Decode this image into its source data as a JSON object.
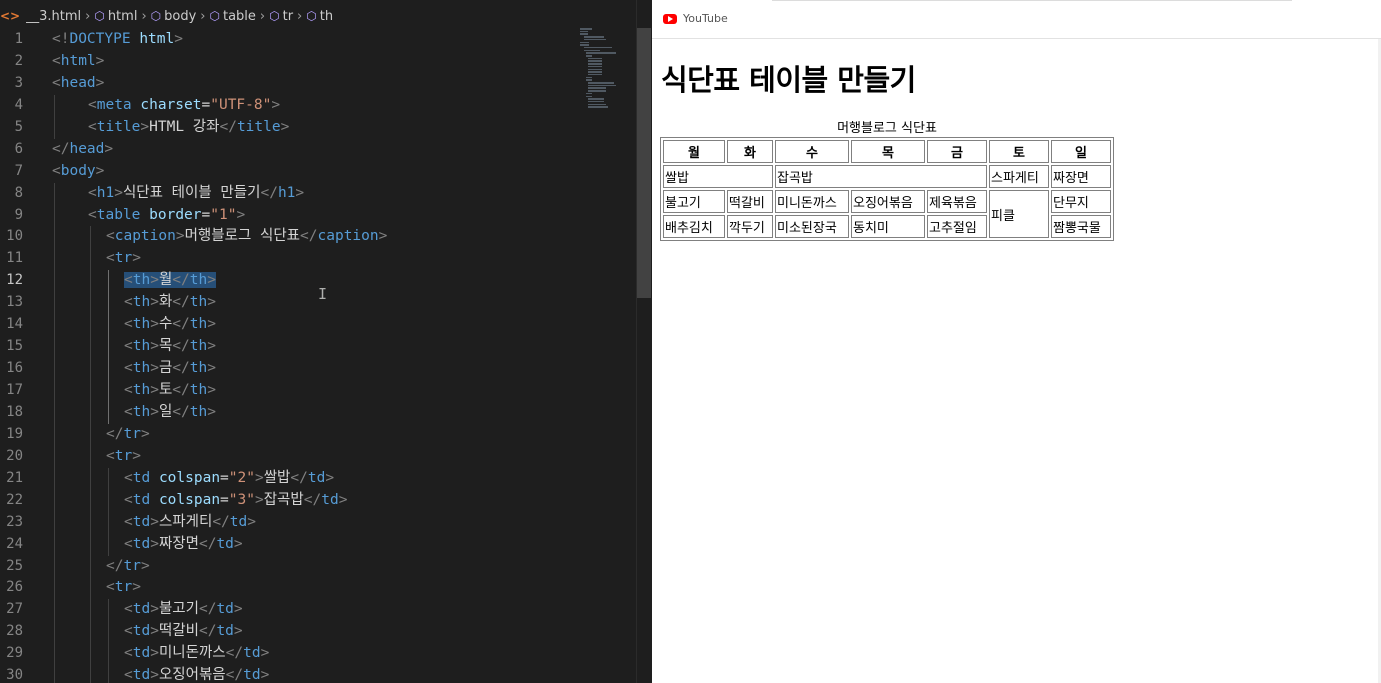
{
  "breadcrumb": {
    "file_icon": "<>",
    "items": [
      "__3.html",
      "html",
      "body",
      "table",
      "tr",
      "th"
    ]
  },
  "editor": {
    "active_line": 12,
    "lines": [
      {
        "n": 1,
        "indent": 0,
        "tokens": [
          [
            "b",
            "<!"
          ],
          [
            "t",
            "DOCTYPE"
          ],
          [
            "x",
            " "
          ],
          [
            "a",
            "html"
          ],
          [
            "b",
            ">"
          ]
        ]
      },
      {
        "n": 2,
        "indent": 0,
        "tokens": [
          [
            "b",
            "<"
          ],
          [
            "t",
            "html"
          ],
          [
            "b",
            ">"
          ]
        ]
      },
      {
        "n": 3,
        "indent": 0,
        "tokens": [
          [
            "b",
            "<"
          ],
          [
            "t",
            "head"
          ],
          [
            "b",
            ">"
          ]
        ]
      },
      {
        "n": 4,
        "indent": 1,
        "tokens": [
          [
            "b",
            "<"
          ],
          [
            "t",
            "meta"
          ],
          [
            "x",
            " "
          ],
          [
            "a",
            "charset"
          ],
          [
            "e",
            "="
          ],
          [
            "v",
            "\"UTF-8\""
          ],
          [
            "b",
            ">"
          ]
        ]
      },
      {
        "n": 5,
        "indent": 1,
        "tokens": [
          [
            "b",
            "<"
          ],
          [
            "t",
            "title"
          ],
          [
            "b",
            ">"
          ],
          [
            "x",
            "HTML 강좌"
          ],
          [
            "b",
            "</"
          ],
          [
            "t",
            "title"
          ],
          [
            "b",
            ">"
          ]
        ]
      },
      {
        "n": 6,
        "indent": 0,
        "tokens": [
          [
            "b",
            "</"
          ],
          [
            "t",
            "head"
          ],
          [
            "b",
            ">"
          ]
        ]
      },
      {
        "n": 7,
        "indent": 0,
        "tokens": [
          [
            "b",
            "<"
          ],
          [
            "t",
            "body"
          ],
          [
            "b",
            ">"
          ]
        ]
      },
      {
        "n": 8,
        "indent": 1,
        "tokens": [
          [
            "b",
            "<"
          ],
          [
            "t",
            "h1"
          ],
          [
            "b",
            ">"
          ],
          [
            "x",
            "식단표 테이블 만들기"
          ],
          [
            "b",
            "</"
          ],
          [
            "t",
            "h1"
          ],
          [
            "b",
            ">"
          ]
        ]
      },
      {
        "n": 9,
        "indent": 1,
        "tokens": [
          [
            "b",
            "<"
          ],
          [
            "t",
            "table"
          ],
          [
            "x",
            " "
          ],
          [
            "a",
            "border"
          ],
          [
            "e",
            "="
          ],
          [
            "v",
            "\"1\""
          ],
          [
            "b",
            ">"
          ]
        ]
      },
      {
        "n": 10,
        "indent": 2,
        "tokens": [
          [
            "b",
            "<"
          ],
          [
            "t",
            "caption"
          ],
          [
            "b",
            ">"
          ],
          [
            "x",
            "머행블로그 식단표"
          ],
          [
            "b",
            "</"
          ],
          [
            "t",
            "caption"
          ],
          [
            "b",
            ">"
          ]
        ]
      },
      {
        "n": 11,
        "indent": 2,
        "tokens": [
          [
            "b",
            "<"
          ],
          [
            "t",
            "tr"
          ],
          [
            "b",
            ">"
          ]
        ]
      },
      {
        "n": 12,
        "indent": 3,
        "selected": true,
        "tokens": [
          [
            "b",
            "<"
          ],
          [
            "t",
            "th"
          ],
          [
            "b",
            ">"
          ],
          [
            "x",
            "월"
          ],
          [
            "b",
            "</"
          ],
          [
            "t",
            "th"
          ],
          [
            "b",
            ">"
          ]
        ]
      },
      {
        "n": 13,
        "indent": 3,
        "tokens": [
          [
            "b",
            "<"
          ],
          [
            "t",
            "th"
          ],
          [
            "b",
            ">"
          ],
          [
            "x",
            "화"
          ],
          [
            "b",
            "</"
          ],
          [
            "t",
            "th"
          ],
          [
            "b",
            ">"
          ]
        ]
      },
      {
        "n": 14,
        "indent": 3,
        "tokens": [
          [
            "b",
            "<"
          ],
          [
            "t",
            "th"
          ],
          [
            "b",
            ">"
          ],
          [
            "x",
            "수"
          ],
          [
            "b",
            "</"
          ],
          [
            "t",
            "th"
          ],
          [
            "b",
            ">"
          ]
        ]
      },
      {
        "n": 15,
        "indent": 3,
        "tokens": [
          [
            "b",
            "<"
          ],
          [
            "t",
            "th"
          ],
          [
            "b",
            ">"
          ],
          [
            "x",
            "목"
          ],
          [
            "b",
            "</"
          ],
          [
            "t",
            "th"
          ],
          [
            "b",
            ">"
          ]
        ]
      },
      {
        "n": 16,
        "indent": 3,
        "tokens": [
          [
            "b",
            "<"
          ],
          [
            "t",
            "th"
          ],
          [
            "b",
            ">"
          ],
          [
            "x",
            "금"
          ],
          [
            "b",
            "</"
          ],
          [
            "t",
            "th"
          ],
          [
            "b",
            ">"
          ]
        ]
      },
      {
        "n": 17,
        "indent": 3,
        "tokens": [
          [
            "b",
            "<"
          ],
          [
            "t",
            "th"
          ],
          [
            "b",
            ">"
          ],
          [
            "x",
            "토"
          ],
          [
            "b",
            "</"
          ],
          [
            "t",
            "th"
          ],
          [
            "b",
            ">"
          ]
        ]
      },
      {
        "n": 18,
        "indent": 3,
        "tokens": [
          [
            "b",
            "<"
          ],
          [
            "t",
            "th"
          ],
          [
            "b",
            ">"
          ],
          [
            "x",
            "일"
          ],
          [
            "b",
            "</"
          ],
          [
            "t",
            "th"
          ],
          [
            "b",
            ">"
          ]
        ]
      },
      {
        "n": 19,
        "indent": 2,
        "tokens": [
          [
            "b",
            "</"
          ],
          [
            "t",
            "tr"
          ],
          [
            "b",
            ">"
          ]
        ]
      },
      {
        "n": 20,
        "indent": 2,
        "tokens": [
          [
            "b",
            "<"
          ],
          [
            "t",
            "tr"
          ],
          [
            "b",
            ">"
          ]
        ]
      },
      {
        "n": 21,
        "indent": 3,
        "tokens": [
          [
            "b",
            "<"
          ],
          [
            "t",
            "td"
          ],
          [
            "x",
            " "
          ],
          [
            "a",
            "colspan"
          ],
          [
            "e",
            "="
          ],
          [
            "v",
            "\"2\""
          ],
          [
            "b",
            ">"
          ],
          [
            "x",
            "쌀밥"
          ],
          [
            "b",
            "</"
          ],
          [
            "t",
            "td"
          ],
          [
            "b",
            ">"
          ]
        ]
      },
      {
        "n": 22,
        "indent": 3,
        "tokens": [
          [
            "b",
            "<"
          ],
          [
            "t",
            "td"
          ],
          [
            "x",
            " "
          ],
          [
            "a",
            "colspan"
          ],
          [
            "e",
            "="
          ],
          [
            "v",
            "\"3\""
          ],
          [
            "b",
            ">"
          ],
          [
            "x",
            "잡곡밥"
          ],
          [
            "b",
            "</"
          ],
          [
            "t",
            "td"
          ],
          [
            "b",
            ">"
          ]
        ]
      },
      {
        "n": 23,
        "indent": 3,
        "tokens": [
          [
            "b",
            "<"
          ],
          [
            "t",
            "td"
          ],
          [
            "b",
            ">"
          ],
          [
            "x",
            "스파게티"
          ],
          [
            "b",
            "</"
          ],
          [
            "t",
            "td"
          ],
          [
            "b",
            ">"
          ]
        ]
      },
      {
        "n": 24,
        "indent": 3,
        "tokens": [
          [
            "b",
            "<"
          ],
          [
            "t",
            "td"
          ],
          [
            "b",
            ">"
          ],
          [
            "x",
            "짜장면"
          ],
          [
            "b",
            "</"
          ],
          [
            "t",
            "td"
          ],
          [
            "b",
            ">"
          ]
        ]
      },
      {
        "n": 25,
        "indent": 2,
        "tokens": [
          [
            "b",
            "</"
          ],
          [
            "t",
            "tr"
          ],
          [
            "b",
            ">"
          ]
        ]
      },
      {
        "n": 26,
        "indent": 2,
        "tokens": [
          [
            "b",
            "<"
          ],
          [
            "t",
            "tr"
          ],
          [
            "b",
            ">"
          ]
        ]
      },
      {
        "n": 27,
        "indent": 3,
        "tokens": [
          [
            "b",
            "<"
          ],
          [
            "t",
            "td"
          ],
          [
            "b",
            ">"
          ],
          [
            "x",
            "불고기"
          ],
          [
            "b",
            "</"
          ],
          [
            "t",
            "td"
          ],
          [
            "b",
            ">"
          ]
        ]
      },
      {
        "n": 28,
        "indent": 3,
        "tokens": [
          [
            "b",
            "<"
          ],
          [
            "t",
            "td"
          ],
          [
            "b",
            ">"
          ],
          [
            "x",
            "떡갈비"
          ],
          [
            "b",
            "</"
          ],
          [
            "t",
            "td"
          ],
          [
            "b",
            ">"
          ]
        ]
      },
      {
        "n": 29,
        "indent": 3,
        "tokens": [
          [
            "b",
            "<"
          ],
          [
            "t",
            "td"
          ],
          [
            "b",
            ">"
          ],
          [
            "x",
            "미니돈까스"
          ],
          [
            "b",
            "</"
          ],
          [
            "t",
            "td"
          ],
          [
            "b",
            ">"
          ]
        ]
      },
      {
        "n": 30,
        "indent": 3,
        "tokens": [
          [
            "b",
            "<"
          ],
          [
            "t",
            "td"
          ],
          [
            "b",
            ">"
          ],
          [
            "x",
            "오징어볶음"
          ],
          [
            "b",
            "</"
          ],
          [
            "t",
            "td"
          ],
          [
            "b",
            ">"
          ]
        ]
      }
    ]
  },
  "bookmarks": {
    "youtube_label": "YouTube"
  },
  "preview": {
    "heading": "식단표 테이블 만들기",
    "caption": "머행블로그 식단표",
    "headers": [
      "월",
      "화",
      "수",
      "목",
      "금",
      "토",
      "일"
    ],
    "rows": [
      [
        {
          "text": "쌀밥",
          "colspan": 2
        },
        {
          "text": "잡곡밥",
          "colspan": 3
        },
        {
          "text": "스파게티"
        },
        {
          "text": "짜장면"
        }
      ],
      [
        {
          "text": "불고기"
        },
        {
          "text": "떡갈비"
        },
        {
          "text": "미니돈까스"
        },
        {
          "text": "오징어볶음"
        },
        {
          "text": "제육볶음"
        },
        {
          "text": "피클",
          "rowspan": 2
        },
        {
          "text": "단무지"
        }
      ],
      [
        {
          "text": "배추김치"
        },
        {
          "text": "깍두기"
        },
        {
          "text": "미소된장국"
        },
        {
          "text": "동치미"
        },
        {
          "text": "고추절임"
        },
        {
          "text": "짬뽕국물"
        }
      ]
    ]
  },
  "colors": {
    "editor_bg": "#1e1e1e",
    "tag": "#569cd6",
    "attr": "#9cdcfe",
    "value": "#ce9178",
    "text": "#d4d4d4",
    "selection": "#264f78",
    "youtube_red": "#ff0000"
  }
}
